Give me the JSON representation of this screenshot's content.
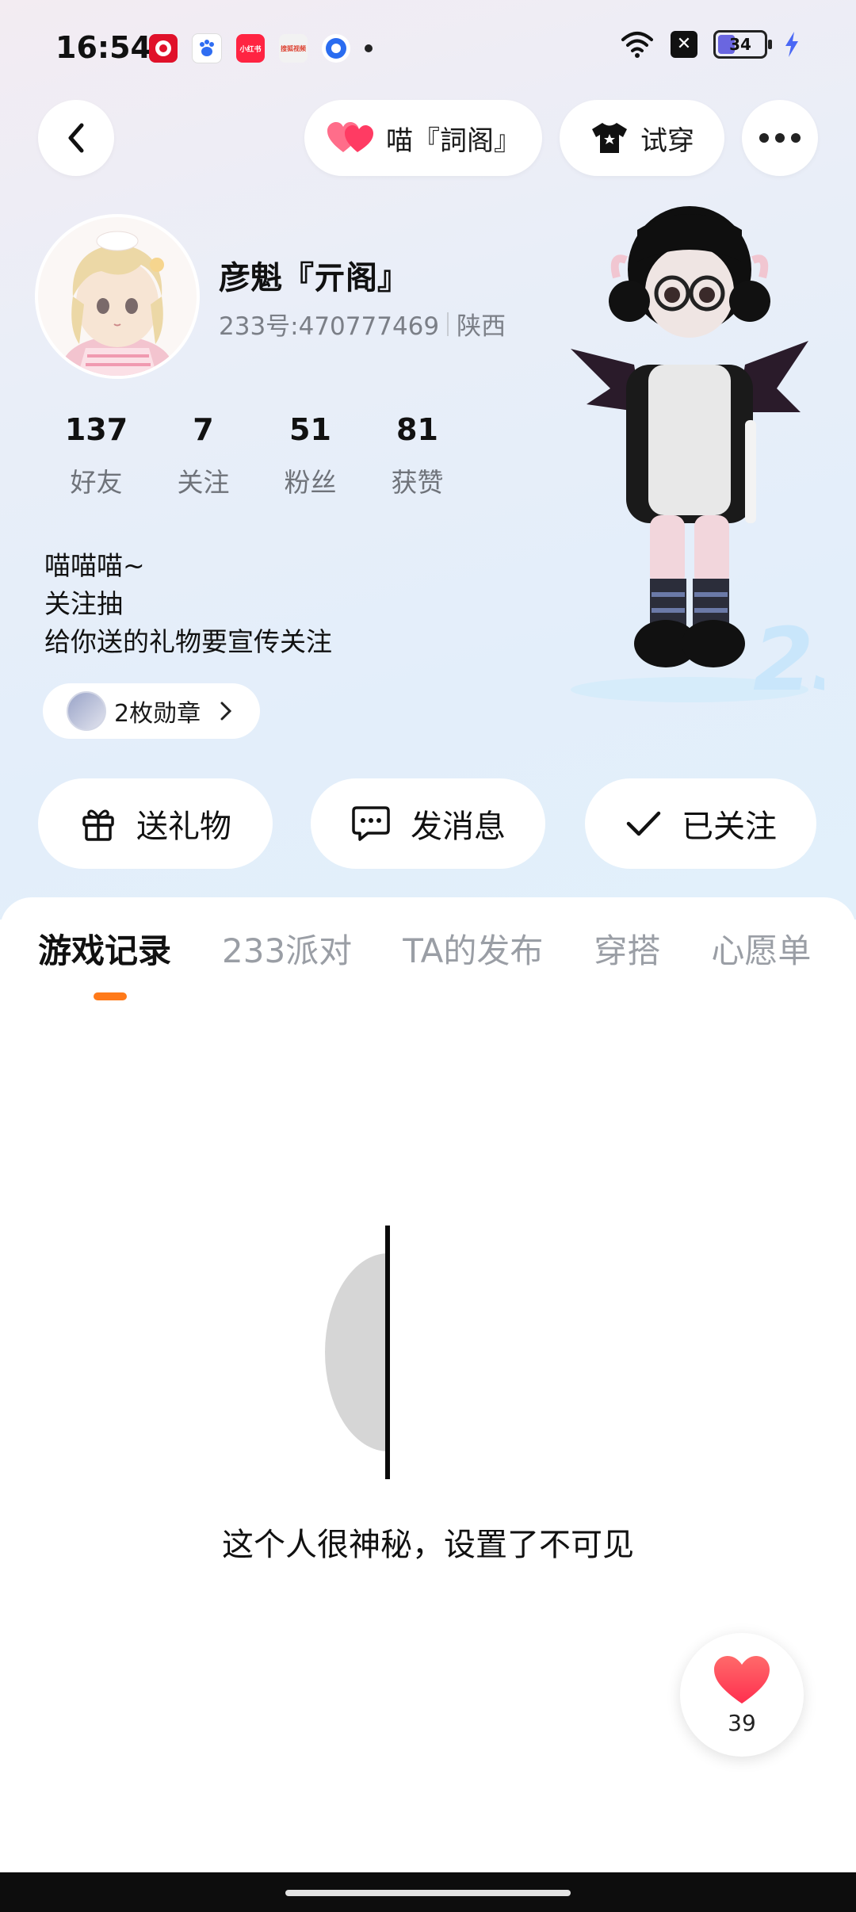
{
  "status_bar": {
    "time": "16:54",
    "app_icons": [
      {
        "name": "pinduoduo-icon",
        "color": "#e0112a",
        "label": ""
      },
      {
        "name": "baidu-icon",
        "color": "#2f6df2",
        "label": ""
      },
      {
        "name": "xiaohongshu-icon",
        "color": "#ff2442",
        "label": "小红书"
      },
      {
        "name": "sohu-video-icon",
        "color": "#f2f2f2",
        "label": "搜狐视频"
      },
      {
        "name": "blue-app-icon",
        "color": "#2a6cf0",
        "label": ""
      }
    ],
    "battery_level": "34",
    "battery_fraction": 0.34
  },
  "header": {
    "title_pill": "喵『詞阁』",
    "try_on_label": "试穿"
  },
  "profile": {
    "name": "彦魁『亓阁』",
    "id_text": "233号:470777469",
    "region": "陕西",
    "stats": [
      {
        "value": "137",
        "label": "好友"
      },
      {
        "value": "7",
        "label": "关注"
      },
      {
        "value": "51",
        "label": "粉丝"
      },
      {
        "value": "81",
        "label": "获赞"
      }
    ],
    "bio": [
      "喵喵喵~",
      "关注抽",
      "给你送的礼物要宣传关注"
    ],
    "badge_label": "2枚勋章"
  },
  "actions": {
    "gift": "送礼物",
    "message": "发消息",
    "follow": "已关注"
  },
  "tabs": [
    "游戏记录",
    "233派对",
    "TA的发布",
    "穿搭",
    "心愿单"
  ],
  "active_tab": "游戏记录",
  "empty_state": {
    "text": "这个人很神秘，设置了不可见"
  },
  "like_fab": {
    "count": "39"
  },
  "colors": {
    "accent": "#ff7a1a",
    "heart": "#ff4b6b"
  }
}
